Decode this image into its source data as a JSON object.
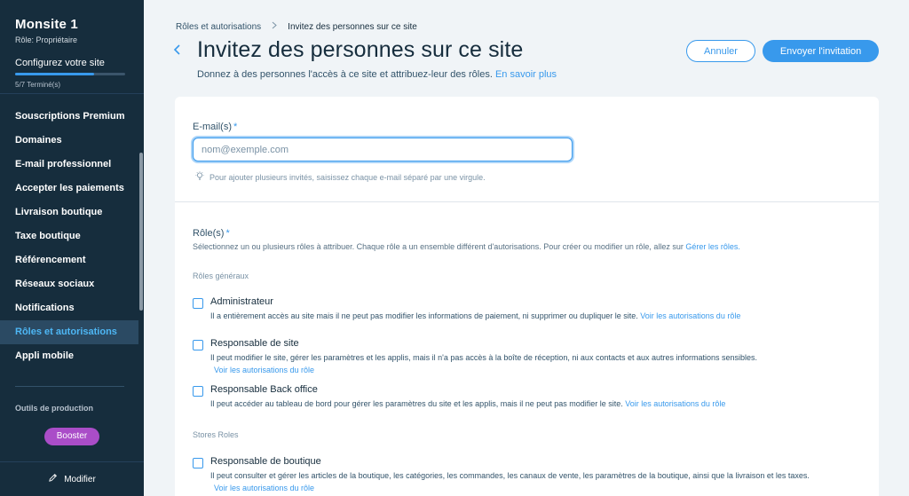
{
  "sidebar": {
    "site_name": "Monsite 1",
    "role": "Rôle: Propriétaire",
    "setup_label": "Configurez votre site",
    "progress": {
      "done": 5,
      "total": 7,
      "text": "5/7 Terminé(s)"
    },
    "items": [
      {
        "label": "Souscriptions Premium"
      },
      {
        "label": "Domaines"
      },
      {
        "label": "E-mail professionnel"
      },
      {
        "label": "Accepter les paiements"
      },
      {
        "label": "Livraison boutique"
      },
      {
        "label": "Taxe boutique"
      },
      {
        "label": "Référencement"
      },
      {
        "label": "Réseaux sociaux"
      },
      {
        "label": "Notifications"
      },
      {
        "label": "Rôles et autorisations",
        "active": true
      },
      {
        "label": "Appli mobile"
      }
    ],
    "tools_label": "Outils de production",
    "boost_label": "Booster",
    "footer_label": "Modifier"
  },
  "header": {
    "breadcrumb": [
      "Rôles et autorisations",
      "Invitez des personnes sur ce site"
    ],
    "title": "Invitez des personnes sur ce site",
    "subtitle": "Donnez à des personnes l'accès à ce site et attribuez-leur des rôles.",
    "learn_more": "En savoir plus",
    "cancel_label": "Annuler",
    "send_label": "Envoyer l'invitation"
  },
  "form": {
    "email_label": "E-mail(s)",
    "required_mark": "*",
    "email_value": "",
    "email_placeholder": "nom@exemple.com",
    "email_hint": "Pour ajouter plusieurs invités, saisissez chaque e-mail séparé par une virgule.",
    "roles_label": "Rôle(s)",
    "roles_desc": "Sélectionnez un ou plusieurs rôles à attribuer. Chaque rôle a un ensemble différent d'autorisations. Pour créer ou modifier un rôle, allez sur",
    "roles_link": "Gérer les rôles.",
    "general_group": "Rôles généraux",
    "roles": [
      {
        "name": "Administrateur",
        "desc": "Il a entièrement accès au site mais il ne peut pas modifier les informations de paiement, ni supprimer ou dupliquer le site.",
        "link": "Voir les autorisations du rôle",
        "checked": false
      },
      {
        "name": "Responsable de site",
        "desc": "Il peut modifier le site, gérer les paramètres et les applis, mais il n'a pas accès à la boîte de réception, ni aux contacts et aux autres informations sensibles.",
        "link": "Voir les autorisations du rôle",
        "checked": false
      },
      {
        "name": "Responsable Back office",
        "desc": "Il peut accéder au tableau de bord pour gérer les paramètres du site et les applis, mais il ne peut pas modifier le site.",
        "link": "Voir les autorisations du rôle",
        "checked": false
      }
    ],
    "stores_group": "Stores Roles",
    "store_roles": [
      {
        "name": "Responsable de boutique",
        "desc": "Il peut consulter et gérer les articles de la boutique, les catégories, les commandes, les canaux de vente, les paramètres de la boutique, ainsi que la livraison et les taxes.",
        "link": "Voir les autorisations du rôle",
        "checked": false
      }
    ]
  },
  "colors": {
    "sidebar_bg": "#162d3d",
    "accent": "#3899ec",
    "boost": "#aa4dc8",
    "page_bg": "#f0f4f7"
  }
}
